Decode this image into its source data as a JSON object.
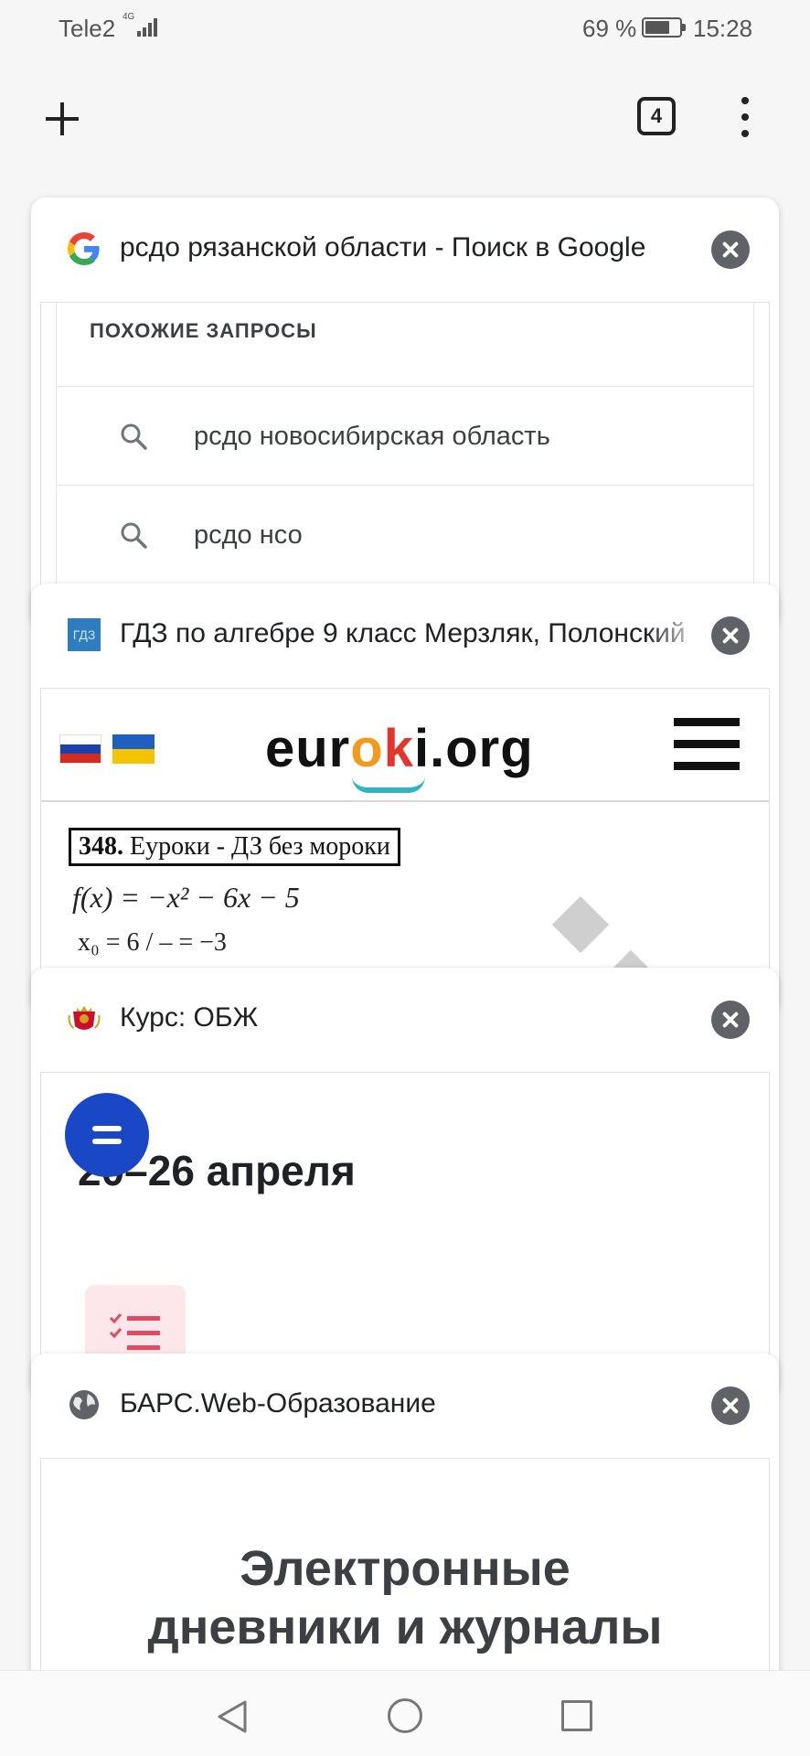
{
  "status_bar": {
    "carrier": "Tele2",
    "network": "4G",
    "battery": "69 %",
    "battery_level": 0.69,
    "time": "15:28"
  },
  "toolbar": {
    "new_tab_icon": "plus-icon",
    "tab_count": "4",
    "menu_icon": "more-vert-icon"
  },
  "tabs": [
    {
      "title": "рсдо рязанской области - Поиск в Google",
      "favicon": "google-g-icon",
      "preview": {
        "section_header": "ПОХОЖИЕ ЗАПРОСЫ",
        "suggestions": [
          "рсдо новосибирская область",
          "рсдо нсо"
        ]
      }
    },
    {
      "title": "ГДЗ по алгебре 9 класс Мерзляк, Полонский",
      "favicon_text": "ГДЗ",
      "preview": {
        "logo": {
          "before": "eur",
          "o": "o",
          "k": "k",
          "after": "i.org"
        },
        "boxed_number": "348.",
        "boxed_text": "Еуроки - ДЗ без мороки",
        "formula": "f(x) = −x² − 6x − 5",
        "fraction_line": "x₀ = 6 / ‒ = −3"
      }
    },
    {
      "title": "Курс: ОБЖ",
      "favicon": "coat-of-arms-icon",
      "preview": {
        "date_range": "20–26 апреля"
      }
    },
    {
      "title": "БАРС.Web-Образование",
      "favicon": "globe-icon",
      "preview": {
        "heading_line1": "Электронные",
        "heading_line2": "дневники и журналы"
      }
    }
  ],
  "navbar": {
    "back": "back-triangle-icon",
    "home": "home-circle-icon",
    "recents": "recents-square-icon"
  }
}
